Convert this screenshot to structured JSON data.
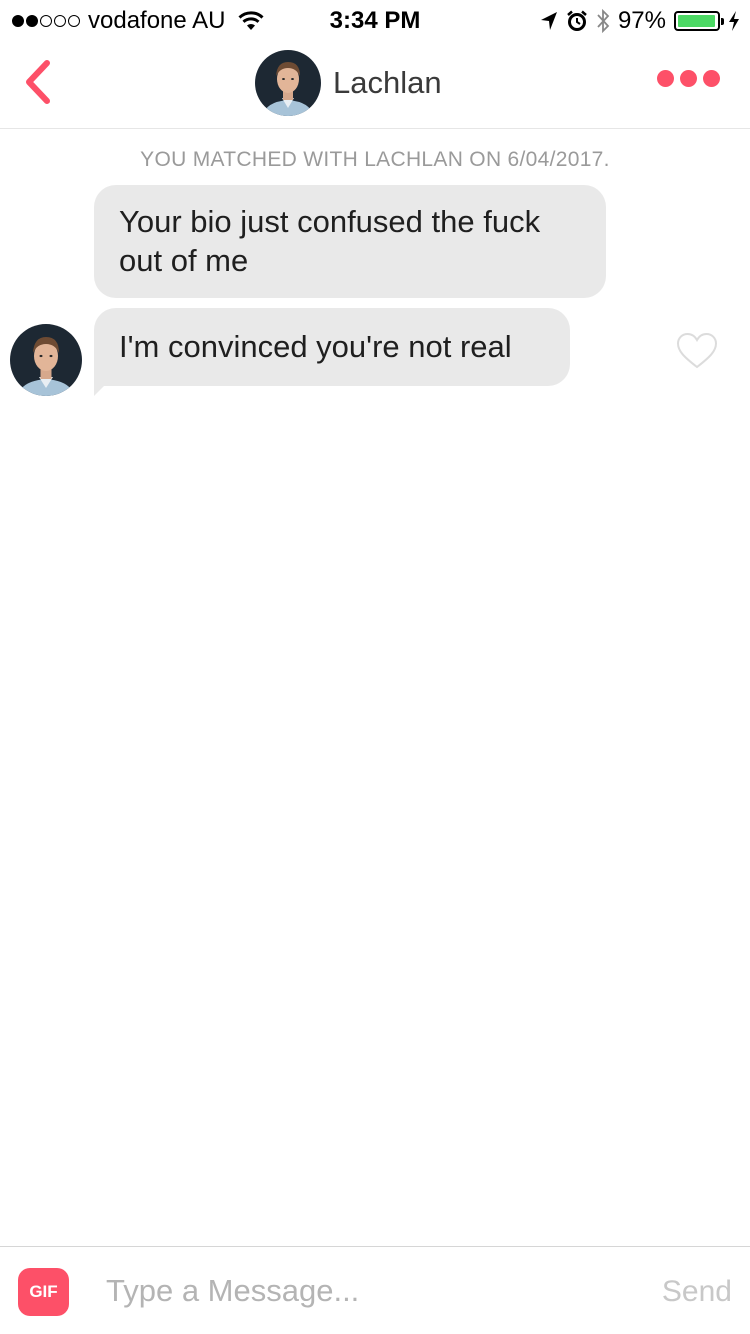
{
  "status_bar": {
    "carrier": "vodafone AU",
    "signal_bars_filled": 2,
    "signal_bars_total": 5,
    "time": "3:34 PM",
    "battery_percent": "97%",
    "battery_level": 0.97,
    "battery_color": "#4cd964",
    "icons": [
      "wifi-icon",
      "location-arrow-icon",
      "alarm-icon",
      "bluetooth-icon",
      "battery-icon",
      "charging-bolt-icon"
    ]
  },
  "nav": {
    "back_icon": "chevron-left-icon",
    "contact_name": "Lachlan",
    "more_icon": "three-dots-icon",
    "accent_color": "#fd5068"
  },
  "chat": {
    "match_notice": "YOU MATCHED WITH LACHLAN ON 6/04/2017.",
    "messages": [
      {
        "text": "Your bio just confused the fuck out of me",
        "from": "Lachlan"
      },
      {
        "text": "I'm convinced you're not real",
        "from": "Lachlan"
      }
    ],
    "like_icon": "heart-outline-icon"
  },
  "composer": {
    "gif_label": "GIF",
    "placeholder": "Type a Message...",
    "send_label": "Send"
  }
}
